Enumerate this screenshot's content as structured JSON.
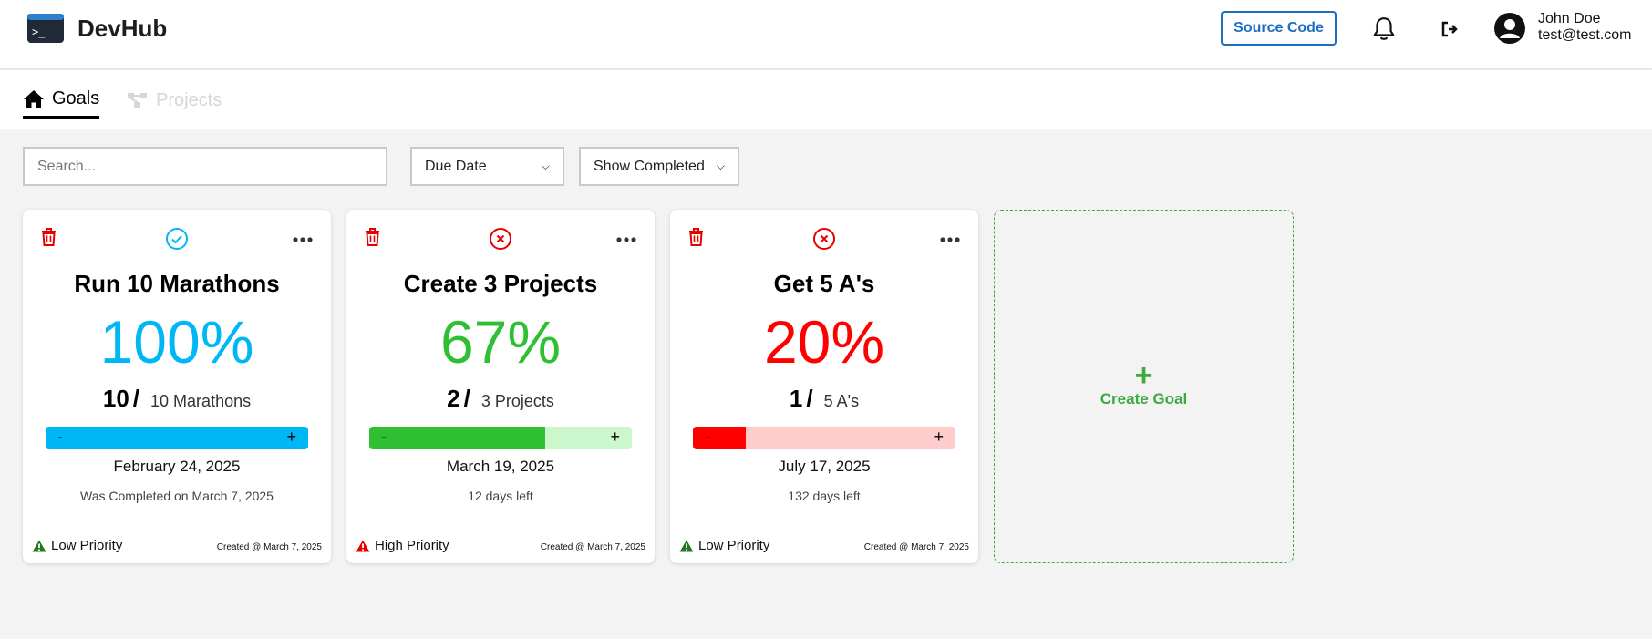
{
  "app": {
    "title": "DevHub"
  },
  "header": {
    "source_label": "Source Code",
    "user_name": "John Doe",
    "user_email": "test@test.com"
  },
  "tabs": [
    {
      "label": "Goals",
      "icon": "home-icon",
      "active": true
    },
    {
      "label": "Projects",
      "icon": "project-tree-icon",
      "active": false
    }
  ],
  "toolbar": {
    "search_placeholder": "Search...",
    "sort_selected": "Due Date",
    "filter_selected": "Show Completed"
  },
  "goals": [
    {
      "title": "Run 10 Marathons",
      "percent_label": "100%",
      "progress": 1.0,
      "current": "10",
      "total": "10 Marathons",
      "due_date": "February 24, 2025",
      "subtext": "Was Completed on March 7, 2025",
      "priority": "Low Priority",
      "created": "Created @ March 7, 2025",
      "status": "completed",
      "color": "#00b7f5",
      "track_color": "#00b7f5",
      "priority_color": "#1f7a1f"
    },
    {
      "title": "Create 3 Projects",
      "percent_label": "67%",
      "progress": 0.67,
      "current": "2",
      "total": "3 Projects",
      "due_date": "March 19, 2025",
      "subtext": "12 days left",
      "priority": "High Priority",
      "created": "Created @ March 7, 2025",
      "status": "incomplete",
      "color": "#2fbf32",
      "track_color": "#ccf7cc",
      "priority_color": "#e60000"
    },
    {
      "title": "Get 5 A's",
      "percent_label": "20%",
      "progress": 0.2,
      "current": "1",
      "total": "5 A's",
      "due_date": "July 17, 2025",
      "subtext": "132 days left",
      "priority": "Low Priority",
      "created": "Created @ March 7, 2025",
      "status": "incomplete",
      "color": "#ff0000",
      "track_color": "#ffcccc",
      "priority_color": "#1f7a1f"
    }
  ],
  "bar_controls": {
    "minus": "-",
    "plus": "+"
  },
  "create_goal": {
    "plus": "+",
    "label": "Create Goal"
  }
}
